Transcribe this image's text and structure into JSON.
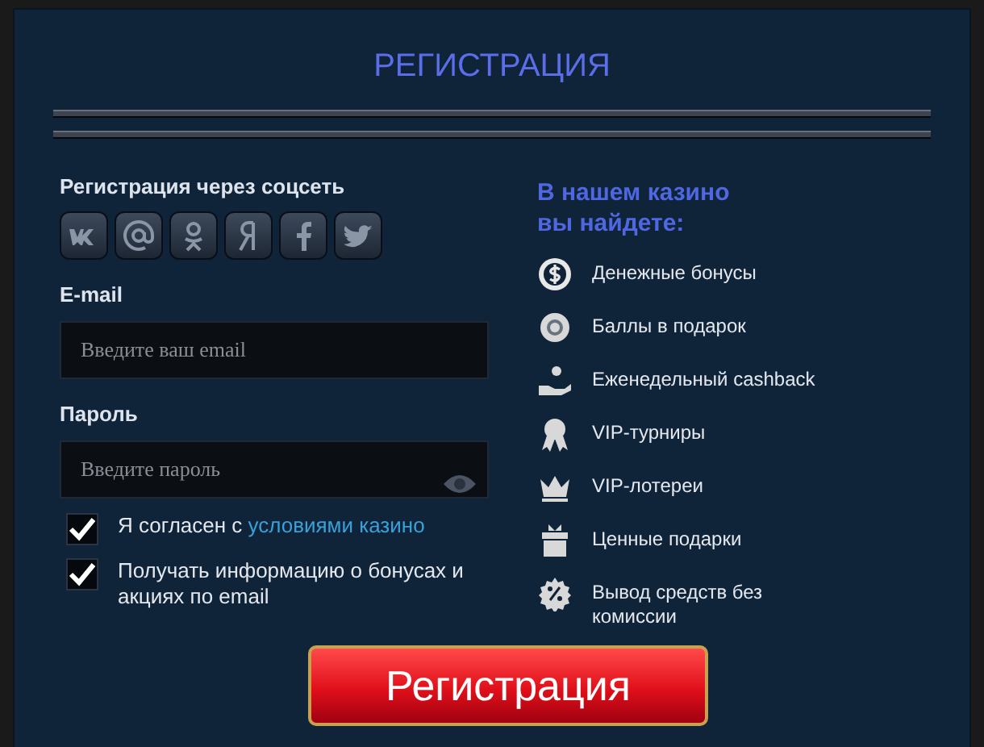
{
  "title": "РЕГИСТРАЦИЯ",
  "social": {
    "label": "Регистрация через соцсеть"
  },
  "email": {
    "label": "E-mail",
    "placeholder": "Введите ваш email"
  },
  "password": {
    "label": "Пароль",
    "placeholder": "Введите пароль"
  },
  "checkboxes": [
    {
      "text": "Я согласен с ",
      "link": "условиями казино",
      "checked": true
    },
    {
      "text": "Получать информацию о бонусах и акциях по email",
      "checked": true
    }
  ],
  "features": {
    "heading": "В нашем казино вы найдете:",
    "items": [
      {
        "text": "Денежные бонусы"
      },
      {
        "text": "Баллы в подарок"
      },
      {
        "text": "Еженедельный cashback"
      },
      {
        "text": "VIP-турниры"
      },
      {
        "text": "VIP-лотереи"
      },
      {
        "text": "Ценные подарки"
      },
      {
        "text": "Вывод средств без комиссии"
      }
    ]
  },
  "submit": "Регистрация"
}
